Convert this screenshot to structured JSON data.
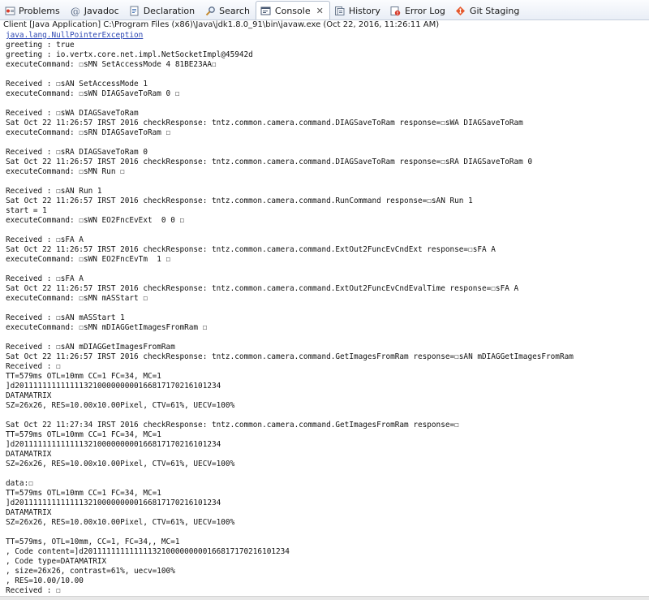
{
  "tabs": [
    {
      "label": "Problems",
      "icon": "problems-icon",
      "active": false
    },
    {
      "label": "Javadoc",
      "icon": "javadoc-icon",
      "active": false
    },
    {
      "label": "Declaration",
      "icon": "declaration-icon",
      "active": false
    },
    {
      "label": "Search",
      "icon": "search-icon",
      "active": false
    },
    {
      "label": "Console",
      "icon": "console-icon",
      "active": true,
      "close": "✕"
    },
    {
      "label": "History",
      "icon": "history-icon",
      "active": false
    },
    {
      "label": "Error Log",
      "icon": "error-log-icon",
      "active": false
    },
    {
      "label": "Git Staging",
      "icon": "git-staging-icon",
      "active": false
    }
  ],
  "console_header": "Client [Java Application] C:\\Program Files (x86)\\Java\\jdk1.8.0_91\\bin\\javaw.exe (Oct 22, 2016, 11:26:11 AM)",
  "console_link": "java.lang.NullPointerException",
  "console_lines": [
    "greeting : true",
    "greeting : io.vertx.core.net.impl.NetSocketImpl@45942d",
    "executeCommand: ☐sMN SetAccessMode 4 81BE23AA☐",
    "",
    "Received : ☐sAN SetAccessMode 1",
    "executeCommand: ☐sWN DIAGSaveToRam 0 ☐",
    "",
    "Received : ☐sWA DIAGSaveToRam",
    "Sat Oct 22 11:26:57 IRST 2016 checkResponse: tntz.common.camera.command.DIAGSaveToRam response=☐sWA DIAGSaveToRam",
    "executeCommand: ☐sRN DIAGSaveToRam ☐",
    "",
    "Received : ☐sRA DIAGSaveToRam 0",
    "Sat Oct 22 11:26:57 IRST 2016 checkResponse: tntz.common.camera.command.DIAGSaveToRam response=☐sRA DIAGSaveToRam 0",
    "executeCommand: ☐sMN Run ☐",
    "",
    "Received : ☐sAN Run 1",
    "Sat Oct 22 11:26:57 IRST 2016 checkResponse: tntz.common.camera.command.RunCommand response=☐sAN Run 1",
    "start = 1",
    "executeCommand: ☐sWN EO2FncEvExt  0 0 ☐",
    "",
    "Received : ☐sFA A",
    "Sat Oct 22 11:26:57 IRST 2016 checkResponse: tntz.common.camera.command.ExtOut2FuncEvCndExt response=☐sFA A",
    "executeCommand: ☐sWN EO2FncEvTm  1 ☐",
    "",
    "Received : ☐sFA A",
    "Sat Oct 22 11:26:57 IRST 2016 checkResponse: tntz.common.camera.command.ExtOut2FuncEvCndEvalTime response=☐sFA A",
    "executeCommand: ☐sMN mASStart ☐",
    "",
    "Received : ☐sAN mASStart 1",
    "executeCommand: ☐sMN mDIAGGetImagesFromRam ☐",
    "",
    "Received : ☐sAN mDIAGGetImagesFromRam",
    "Sat Oct 22 11:26:57 IRST 2016 checkResponse: tntz.common.camera.command.GetImagesFromRam response=☐sAN mDIAGGetImagesFromRam",
    "Received : ☐",
    "TT=579ms OTL=10mm CC=1 FC=34, MC=1",
    "]d201111111111111321000000000166817170216101234",
    "DATAMATRIX",
    "SZ=26x26, RES=10.00x10.00Pixel, CTV=61%, UECV=100%",
    "",
    "Sat Oct 22 11:27:34 IRST 2016 checkResponse: tntz.common.camera.command.GetImagesFromRam response=☐",
    "TT=579ms OTL=10mm CC=1 FC=34, MC=1",
    "]d201111111111111321000000000166817170216101234",
    "DATAMATRIX",
    "SZ=26x26, RES=10.00x10.00Pixel, CTV=61%, UECV=100%",
    "",
    "data:☐",
    "TT=579ms OTL=10mm CC=1 FC=34, MC=1",
    "]d201111111111111321000000000166817170216101234",
    "DATAMATRIX",
    "SZ=26x26, RES=10.00x10.00Pixel, CTV=61%, UECV=100%",
    "",
    "TT=579ms, OTL=10mm, CC=1, FC=34,, MC=1",
    ", Code content=]d201111111111111321000000000166817170216101234",
    ", Code type=DATAMATRIX",
    ", size=26x26, contrast=61%, uecv=100%",
    ", RES=10.00/10.00",
    "Received : ☐"
  ]
}
